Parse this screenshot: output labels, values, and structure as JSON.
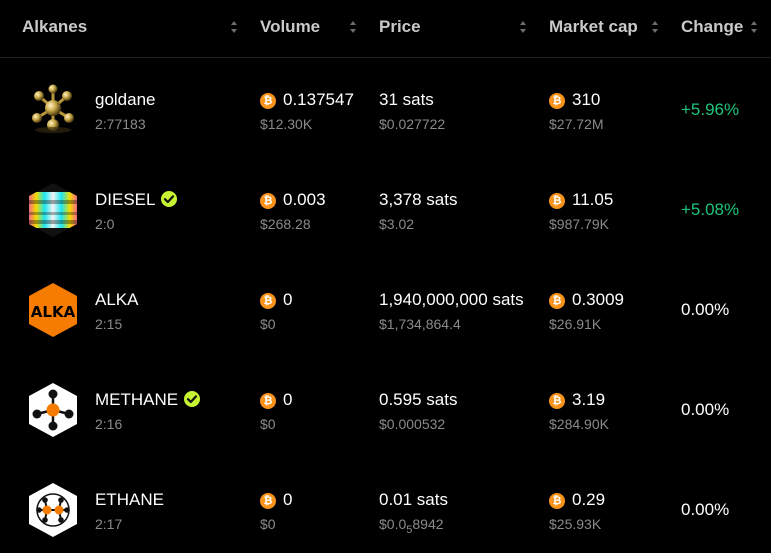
{
  "header": {
    "alkanes": "Alkanes",
    "volume": "Volume",
    "price": "Price",
    "market_cap": "Market cap",
    "change": "Change"
  },
  "colors": {
    "positive": "#1ec47a",
    "btc": "#f7931a",
    "verified": "#c6f432"
  },
  "rows": [
    {
      "name": "goldane",
      "id": "2:77183",
      "verified": false,
      "icon": "goldane-logo-icon",
      "volume": "0.137547",
      "volume_usd": "$12.30K",
      "price": "31 sats",
      "price_usd": "$0.027722",
      "market_cap": "310",
      "market_cap_usd": "$27.72M",
      "change": "+5.96%"
    },
    {
      "name": "DIESEL",
      "id": "2:0",
      "verified": true,
      "icon": "diesel-logo-icon",
      "volume": "0.003",
      "volume_usd": "$268.28",
      "price": "3,378 sats",
      "price_usd": "$3.02",
      "market_cap": "11.05",
      "market_cap_usd": "$987.79K",
      "change": "+5.08%"
    },
    {
      "name": "ALKA",
      "id": "2:15",
      "verified": false,
      "icon": "alka-logo-icon",
      "logo_text": "ALKA",
      "volume": "0",
      "volume_usd": "$0",
      "price": "1,940,000,000 sats",
      "price_usd": "$1,734,864.4",
      "market_cap": "0.3009",
      "market_cap_usd": "$26.91K",
      "change": "0.00%"
    },
    {
      "name": "METHANE",
      "id": "2:16",
      "verified": true,
      "icon": "methane-logo-icon",
      "volume": "0",
      "volume_usd": "$0",
      "price": "0.595 sats",
      "price_usd": "$0.000532",
      "market_cap": "3.19",
      "market_cap_usd": "$284.90K",
      "change": "0.00%"
    },
    {
      "name": "ETHANE",
      "id": "2:17",
      "verified": false,
      "icon": "ethane-logo-icon",
      "volume": "0",
      "volume_usd": "$0",
      "price": "0.01 sats",
      "price_usd_prefix": "$0.0",
      "price_usd_sub": "5",
      "price_usd_suffix": "8942",
      "market_cap": "0.29",
      "market_cap_usd": "$25.93K",
      "change": "0.00%"
    }
  ]
}
